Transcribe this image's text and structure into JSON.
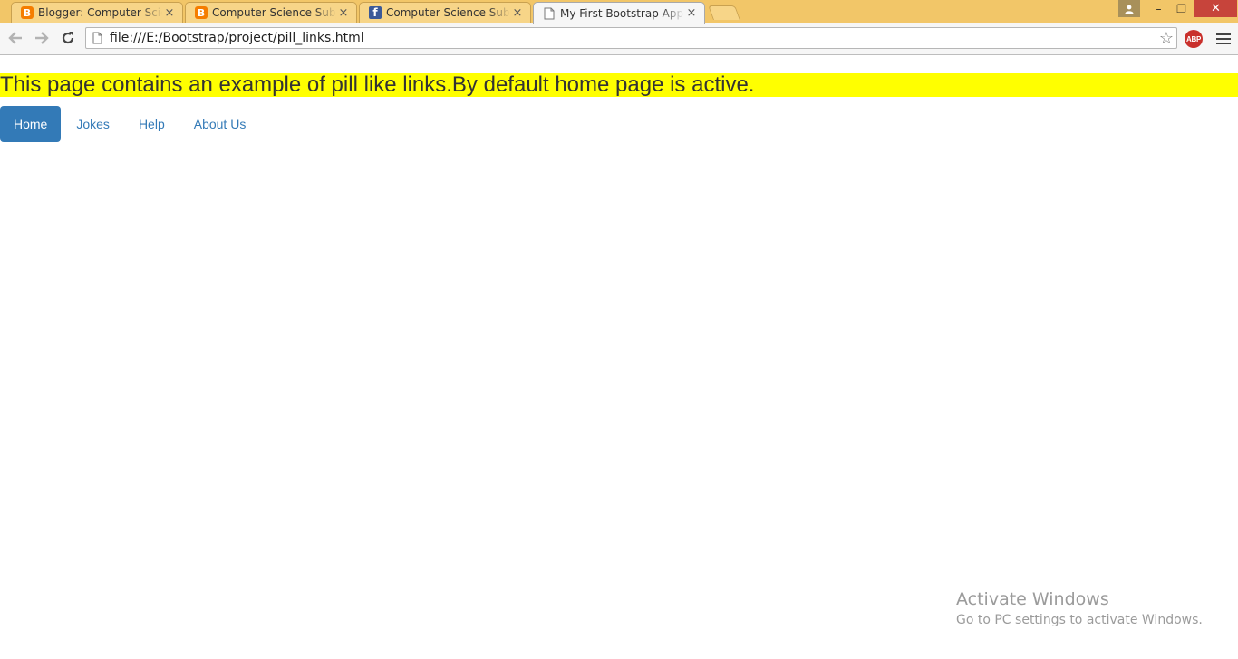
{
  "browser": {
    "tabs": [
      {
        "title": "Blogger: Computer Science",
        "favicon": "blogger-icon",
        "active": false
      },
      {
        "title": "Computer Science Subjects",
        "favicon": "blogger-icon",
        "active": false
      },
      {
        "title": "Computer Science Subjects",
        "favicon": "facebook-icon",
        "active": false
      },
      {
        "title": "My First Bootstrap Application",
        "favicon": "page-icon",
        "active": true
      }
    ],
    "url": "file:///E:/Bootstrap/project/pill_links.html",
    "extension_label": "ABP",
    "tab_close_glyph": "×",
    "window_buttons": {
      "minimize": "–",
      "maximize": "❐",
      "close": "✕"
    }
  },
  "page": {
    "banner_text": "This page contains an example of pill like links.By default home page is active.",
    "banner_color": "#ffff00",
    "pills": [
      {
        "label": "Home",
        "active": true
      },
      {
        "label": "Jokes",
        "active": false
      },
      {
        "label": "Help",
        "active": false
      },
      {
        "label": "About Us",
        "active": false
      }
    ],
    "pill_active_color": "#337ab7"
  },
  "watermark": {
    "line1": "Activate Windows",
    "line2": "Go to PC settings to activate Windows."
  }
}
